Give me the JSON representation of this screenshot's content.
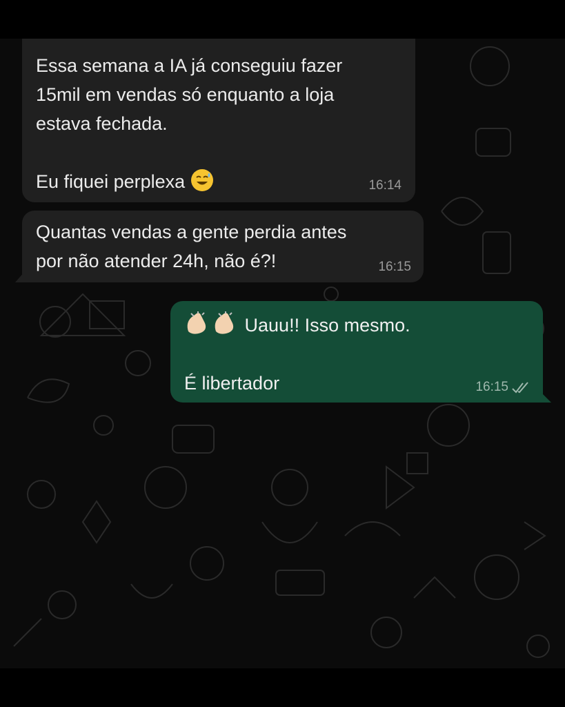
{
  "chat": {
    "messages": [
      {
        "direction": "incoming",
        "lines": [
          "Essa semana a IA já conseguiu fazer",
          "15mil em vendas só enquanto a loja",
          "estava fechada.",
          "",
          "Eu fiquei perplexa"
        ],
        "emoji": "sweat-smile-emoji",
        "time": "16:14"
      },
      {
        "direction": "incoming",
        "lines": [
          "Quantas vendas a gente perdia antes",
          "por não atender 24h, não é?!"
        ],
        "time": "16:15"
      },
      {
        "direction": "outgoing",
        "emoji": "clapping-hands-emoji",
        "text_line1": "Uauu!! Isso mesmo.",
        "text_line2": "É libertador",
        "time": "16:15",
        "status": "read-double-check-icon"
      }
    ]
  },
  "colors": {
    "background": "#0b0b0b",
    "incoming_bubble": "#202020",
    "outgoing_bubble": "#144d37",
    "text": "#ececec",
    "timestamp": "#9a9a9a"
  }
}
